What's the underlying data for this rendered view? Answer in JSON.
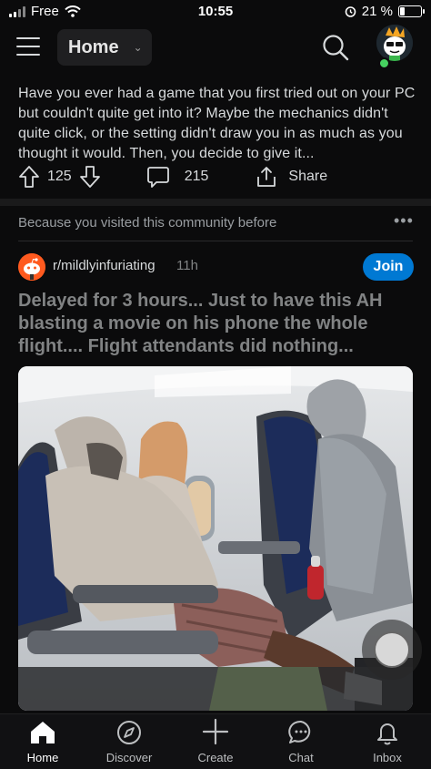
{
  "status_bar": {
    "carrier": "Free",
    "time": "10:55",
    "battery": "21 %"
  },
  "header": {
    "feed_label": "Home"
  },
  "post1": {
    "text": "Have you ever had a game that you first tried out on your PC but couldn't quite get into it? Maybe the mechanics didn't quite click, or the setting didn't draw you in as much as you thought it would. Then, you decide to give it...",
    "upvotes": "125",
    "comments": "215",
    "share_label": "Share"
  },
  "recommendation": {
    "reason": "Because you visited this community before",
    "more": "•••"
  },
  "post2": {
    "community": "r/mildlyinfuriating",
    "age": "11h",
    "join_label": "Join",
    "title": "Delayed for 3 hours... Just to have this AH blasting a movie on his phone the whole flight.... Flight attendants did nothing..."
  },
  "bottom_nav": {
    "items": [
      {
        "label": "Home",
        "icon": "home-icon"
      },
      {
        "label": "Discover",
        "icon": "compass-icon"
      },
      {
        "label": "Create",
        "icon": "plus-icon"
      },
      {
        "label": "Chat",
        "icon": "chat-icon"
      },
      {
        "label": "Inbox",
        "icon": "bell-icon"
      }
    ]
  },
  "colors": {
    "accent": "#0079d3",
    "community_icon": "#ff5a1f",
    "online": "#46d160"
  }
}
